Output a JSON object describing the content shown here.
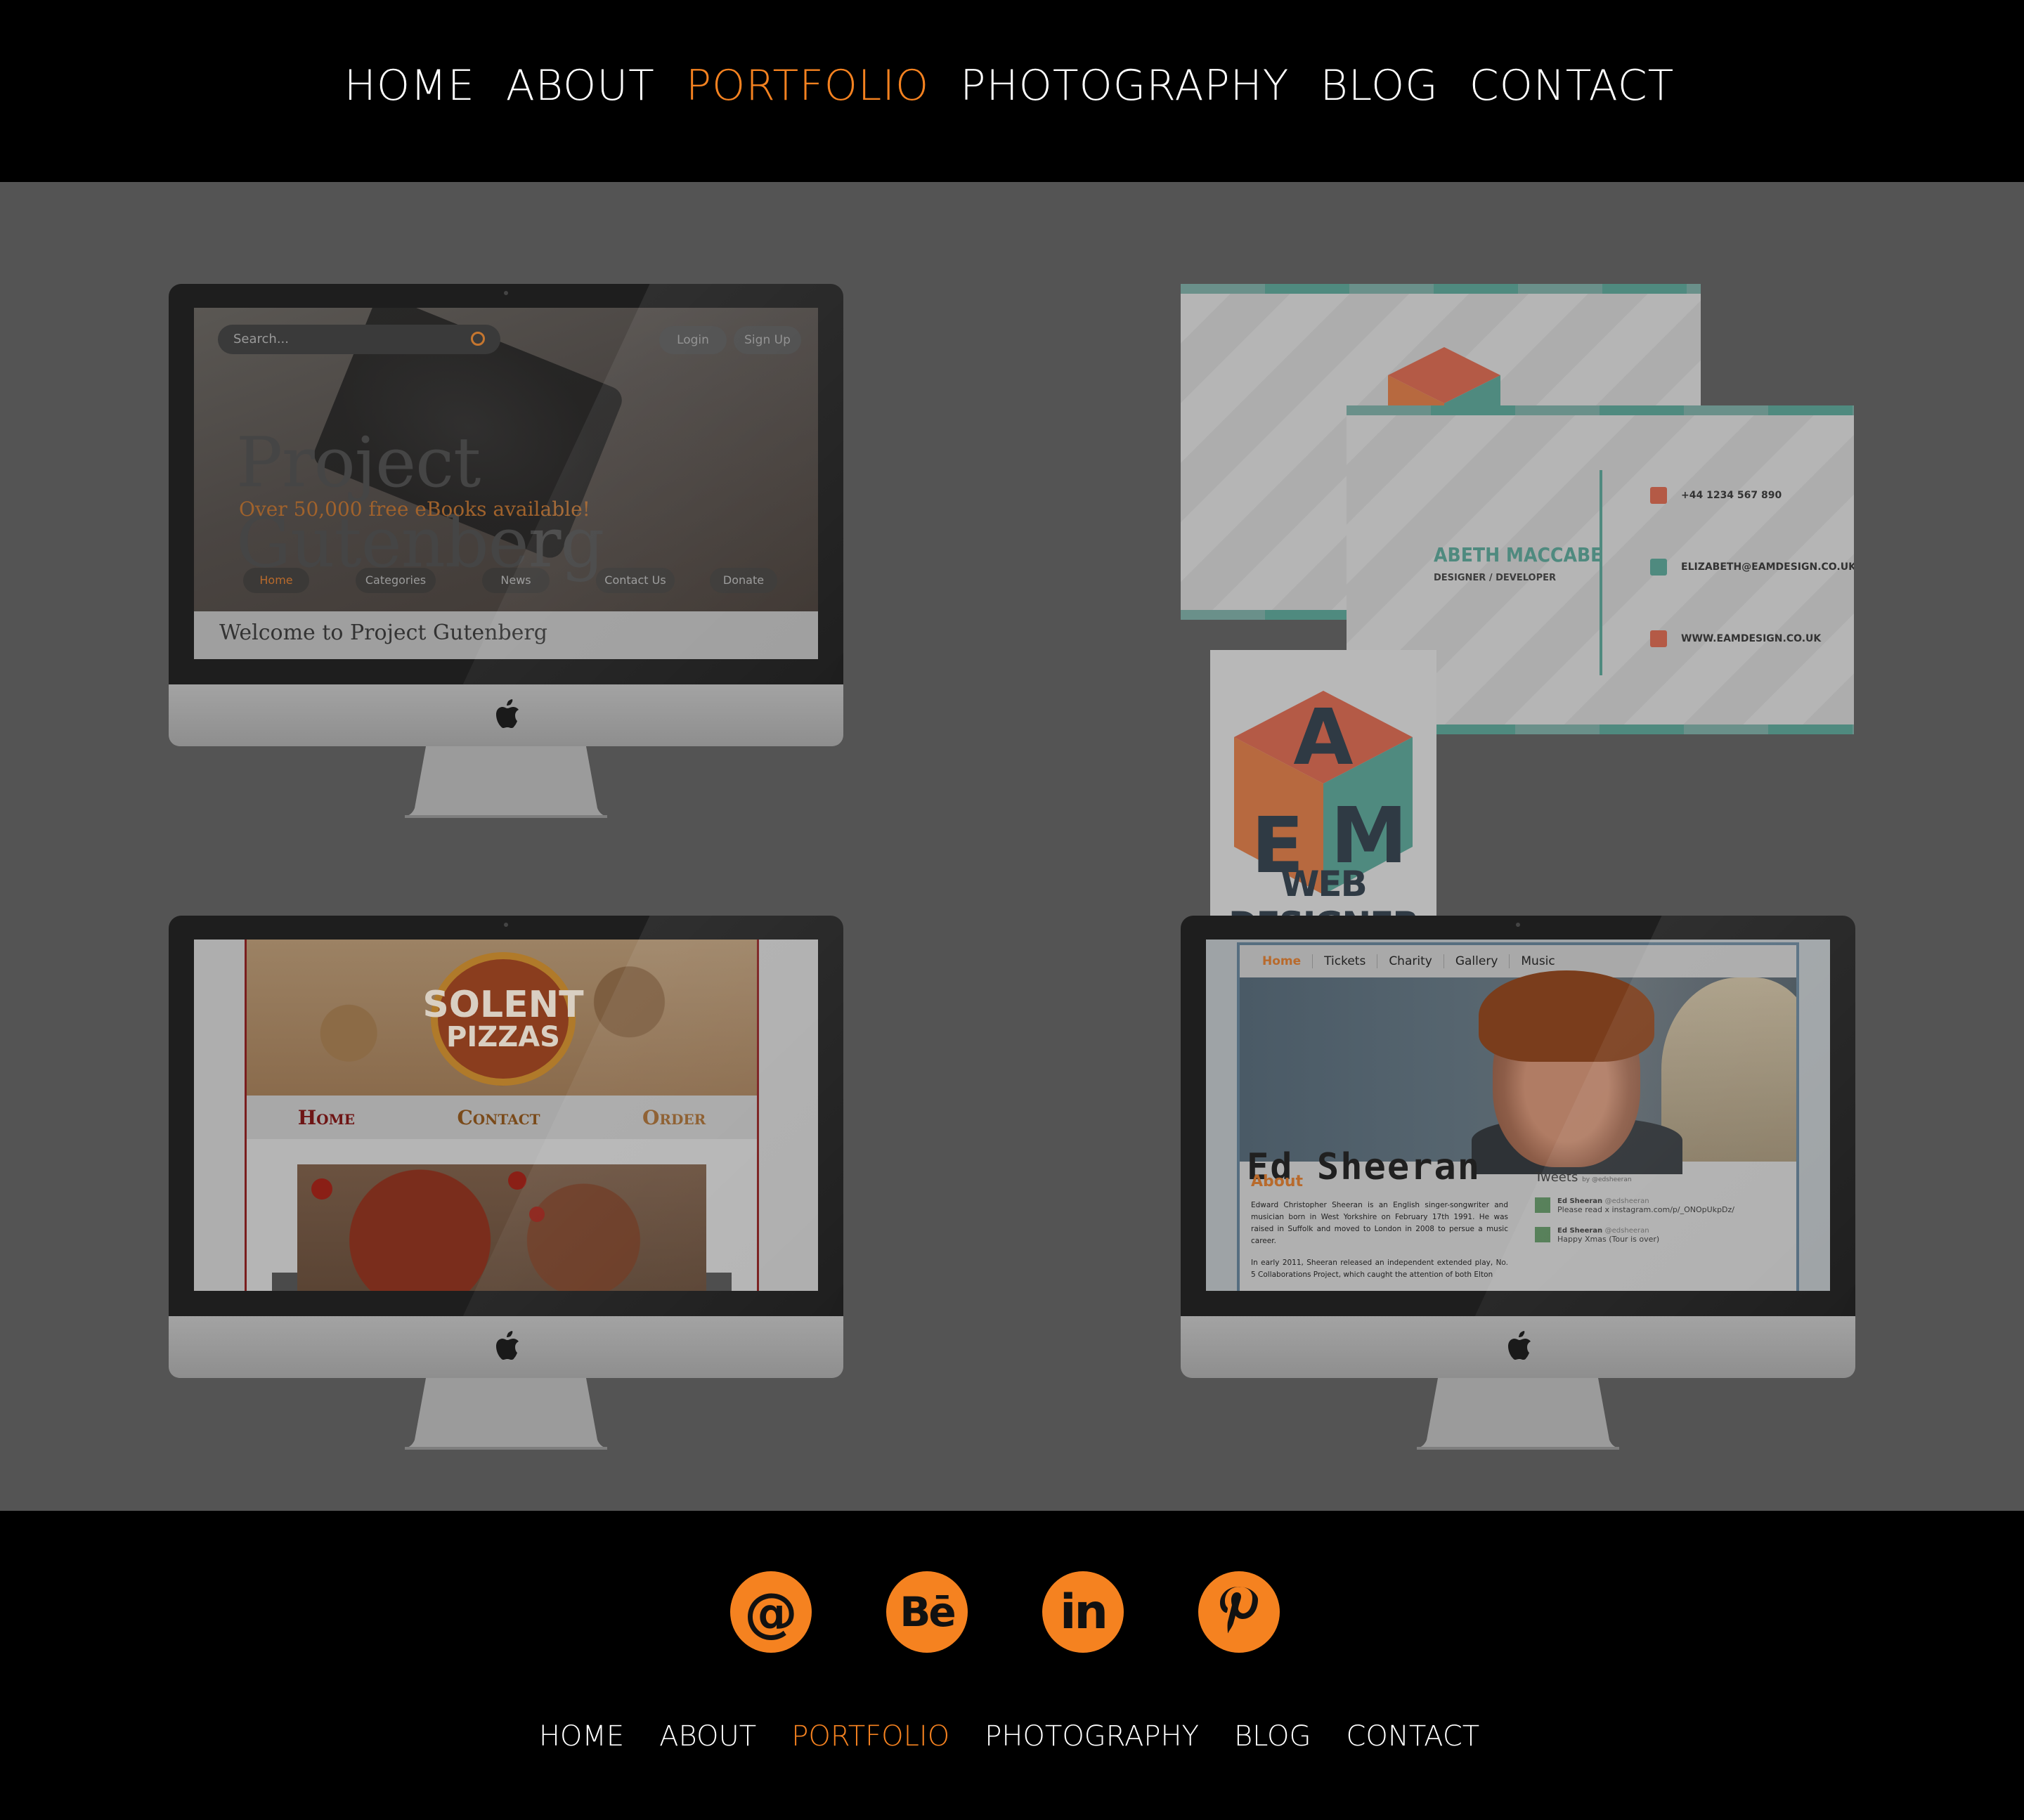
{
  "nav": {
    "items": [
      "HOME",
      "ABOUT",
      "PORTFOLIO",
      "PHOTOGRAPHY",
      "BLOG",
      "CONTACT"
    ],
    "active": "PORTFOLIO"
  },
  "colors": {
    "accent": "#f58220",
    "header_bg": "#000000",
    "main_bg": "#545454"
  },
  "portfolio": {
    "gutenberg": {
      "search_placeholder": "Search...",
      "login": "Login",
      "signup": "Sign Up",
      "title": "Project Gutenberg",
      "subtitle": "Over 50,000 free eBooks available!",
      "nav": [
        "Home",
        "Categories",
        "News",
        "Contact Us",
        "Donate"
      ],
      "welcome": "Welcome to Project Gutenberg"
    },
    "card": {
      "name": "ABETH MACCABE",
      "role": "DESIGNER / DEVELOPER",
      "logo_letters": [
        "A",
        "E",
        "M"
      ],
      "tagline": "WEB DESIGNER",
      "phone": "+44 1234 567 890",
      "email": "ELIZABETH@EAMDESIGN.CO.UK",
      "web": "WWW.EAMDESIGN.CO.UK"
    },
    "pizza": {
      "logo_line1": "SOLENT",
      "logo_line2": "PIZZAS",
      "nav": [
        "Home",
        "Contact",
        "Order"
      ]
    },
    "sheeran": {
      "nav": [
        "Home",
        "Tickets",
        "Charity",
        "Gallery",
        "Music"
      ],
      "wordmark": "Ed Sheeran",
      "about_heading": "About",
      "about_text_1": "Edward Christopher Sheeran is an English singer-songwriter and musician born in West Yorkshire on February 17th 1991. He was raised in Suffolk and moved to London in 2008 to persue a music career.",
      "about_text_2": "In early 2011, Sheeran released an independent extended play, No. 5 Collaborations Project, which caught the attention of both Elton",
      "tweets_heading": "Tweets",
      "tweets_by": "by @edsheeran",
      "tweets": [
        {
          "author": "Ed Sheeran",
          "handle": "@edsheeran",
          "text": "Please read x instagram.com/p/_ONOpUkpDz/"
        },
        {
          "author": "Ed Sheeran",
          "handle": "@edsheeran",
          "text": "Happy Xmas (Tour is over)"
        }
      ]
    }
  },
  "footer": {
    "socials": [
      {
        "icon": "at-email-icon",
        "glyph": "@"
      },
      {
        "icon": "behance-icon",
        "glyph": "Bē"
      },
      {
        "icon": "linkedin-icon",
        "glyph": "in"
      },
      {
        "icon": "pinterest-icon",
        "glyph": "P"
      }
    ],
    "nav": [
      "HOME",
      "ABOUT",
      "PORTFOLIO",
      "PHOTOGRAPHY",
      "BLOG",
      "CONTACT"
    ],
    "active": "PORTFOLIO"
  }
}
